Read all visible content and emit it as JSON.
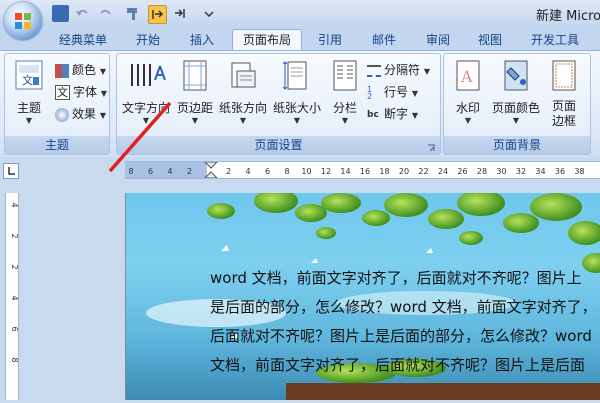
{
  "window": {
    "title": "新建 Micro"
  },
  "tabs": [
    "经典菜单",
    "开始",
    "插入",
    "页面布局",
    "引用",
    "邮件",
    "审阅",
    "视图",
    "开发工具"
  ],
  "active_tab": "页面布局",
  "groups": {
    "theme": {
      "label": "主题",
      "main": "主题",
      "colors": "颜色",
      "fonts": "字体",
      "effects": "效果"
    },
    "page_setup": {
      "label": "页面设置",
      "text_direction": "文字方向",
      "margins": "页边距",
      "orientation": "纸张方向",
      "size": "纸张大小",
      "columns": "分栏",
      "breaks": "分隔符",
      "line_numbers": "行号",
      "hyphenation": "断字"
    },
    "page_background": {
      "label": "页面背景",
      "watermark": "水印",
      "page_color": "页面颜色",
      "page_borders_line1": "页面",
      "page_borders_line2": "边框"
    }
  },
  "ruler": {
    "horizontal_ticks": [
      "8",
      "6",
      "4",
      "2",
      "2",
      "4",
      "6",
      "8",
      "10",
      "12",
      "14",
      "16",
      "18",
      "20",
      "22",
      "24",
      "26",
      "28",
      "30",
      "32",
      "34",
      "36",
      "38"
    ],
    "vertical_ticks": [
      "4",
      "2",
      "2",
      "4",
      "6",
      "8"
    ]
  },
  "document": {
    "lines": [
      "word 文档，前面文字对齐了，后面就对不齐呢？图片上",
      "是后面的部分，怎么修改？word 文档，前面文字对齐了，",
      "后面就对不齐呢？图片上是后面的部分，怎么修改？word",
      "文档，前面文字对齐了，后面就对不齐呢？图片上是后面"
    ]
  },
  "colors": {
    "ribbon_bg": "#dde9f7",
    "tab_text": "#15428b",
    "annotation_line": "#e02020"
  }
}
